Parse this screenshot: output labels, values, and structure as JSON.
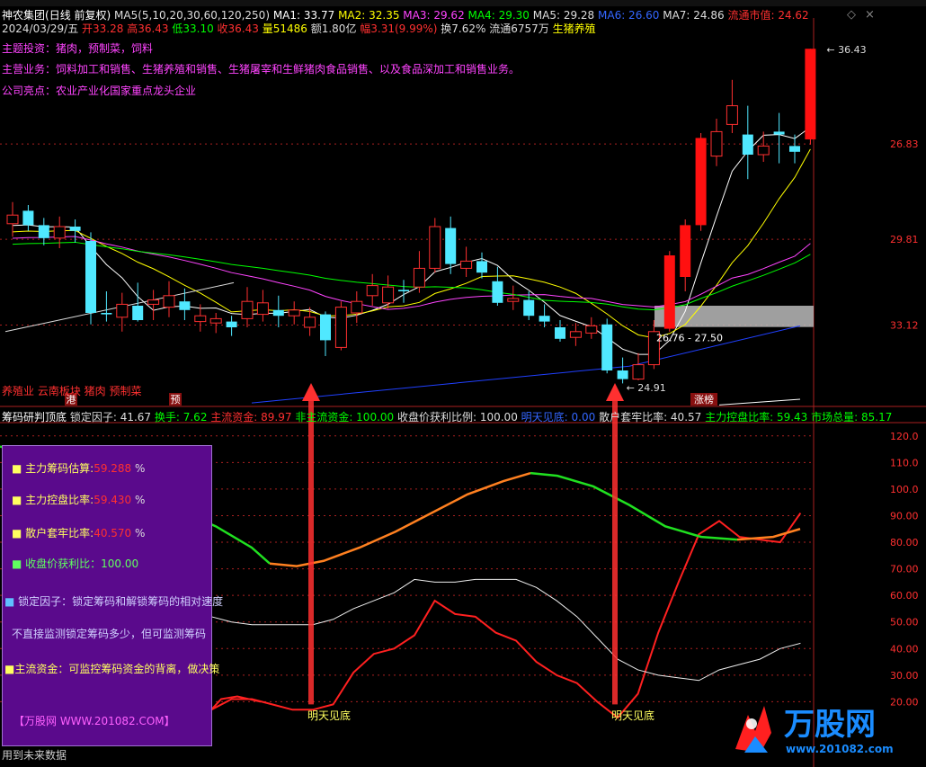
{
  "header": {
    "stock_name": "神农集团",
    "period_label": "(日线 前复权)",
    "ma": [
      {
        "label": "MA5(5,10,20,30,60,120,250)",
        "color": "#dddddd"
      },
      {
        "label": "MA1: 33.77",
        "color": "#ffffff"
      },
      {
        "label": "MA2: 32.35",
        "color": "#ffff00"
      },
      {
        "label": "MA3: 29.62",
        "color": "#ff44ff"
      },
      {
        "label": "MA4: 29.30",
        "color": "#00ff00"
      },
      {
        "label": "MA5: 29.28",
        "color": "#dddddd"
      },
      {
        "label": "MA6: 26.60",
        "color": "#3366ff"
      },
      {
        "label": "MA7: 24.86",
        "color": "#dddddd"
      },
      {
        "label": "流通市值: 24.62",
        "color": "#ff3030"
      }
    ],
    "quote": [
      {
        "label": "2024/03/29/五",
        "color": "#dddddd"
      },
      {
        "label": "开33.28",
        "color": "#ff3030"
      },
      {
        "label": "高36.43",
        "color": "#ff3030"
      },
      {
        "label": "低33.10",
        "color": "#00ff00"
      },
      {
        "label": "收36.43",
        "color": "#ff3030"
      },
      {
        "label": "量51486",
        "color": "#ffff00"
      },
      {
        "label": "额1.80亿",
        "color": "#dddddd"
      },
      {
        "label": "幅3.31(9.99%)",
        "color": "#ff3030"
      },
      {
        "label": "换7.62%",
        "color": "#dddddd"
      },
      {
        "label": "流通6757万",
        "color": "#dddddd"
      },
      {
        "label": "生猪养殖",
        "color": "#ffff00"
      }
    ],
    "info_lines": [
      "主题投资：猪肉，预制菜，饲料",
      "主营业务：饲料加工和销售、生猪养殖和销售、生猪屠宰和生鲜猪肉食品销售、以及食品深加工和销售业务。",
      "公司亮点：农业产业化国家重点龙头企业"
    ],
    "window_controls": [
      "◇",
      "×"
    ]
  },
  "price_panel": {
    "axis_labels": [
      "33.12",
      "29.81",
      "26.83"
    ],
    "high_label": "36.43",
    "low_label": "24.91",
    "zone_label": "26.76 - 27.50",
    "tags": [
      "养殖业 云南板块 猪肉 预制菜"
    ],
    "markers": [
      "港",
      "预",
      "涨榜"
    ]
  },
  "chart_data": [
    {
      "type": "candlestick",
      "title": "神农集团(日线 前复权)",
      "date_last": "2024/03/29",
      "y_ticks": [
        26.83,
        29.81,
        33.12
      ],
      "ylim": [
        24.0,
        37.5
      ],
      "candles": [
        [
          30.35,
          30.65,
          31.1,
          29.9
        ],
        [
          30.8,
          30.3,
          31.0,
          30.1
        ],
        [
          30.3,
          29.85,
          30.55,
          29.6
        ],
        [
          29.85,
          30.25,
          30.6,
          29.5
        ],
        [
          30.25,
          30.1,
          30.5,
          29.7
        ],
        [
          29.75,
          27.25,
          30.05,
          26.85
        ],
        [
          27.25,
          27.2,
          28.0,
          26.95
        ],
        [
          27.1,
          27.55,
          27.95,
          26.6
        ],
        [
          27.5,
          27.0,
          28.3,
          26.95
        ],
        [
          27.55,
          27.7,
          28.05,
          27.0
        ],
        [
          27.45,
          27.85,
          28.35,
          27.1
        ],
        [
          27.65,
          27.35,
          28.1,
          27.0
        ],
        [
          26.95,
          27.15,
          27.55,
          26.6
        ],
        [
          26.9,
          27.05,
          27.25,
          26.55
        ],
        [
          26.95,
          26.75,
          27.15,
          26.45
        ],
        [
          27.05,
          27.65,
          28.15,
          26.75
        ],
        [
          27.2,
          27.6,
          28.05,
          26.95
        ],
        [
          27.35,
          27.15,
          27.85,
          26.75
        ],
        [
          27.15,
          27.35,
          27.65,
          26.85
        ],
        [
          26.75,
          27.1,
          27.45,
          26.45
        ],
        [
          27.2,
          26.3,
          27.3,
          25.75
        ],
        [
          26.05,
          27.45,
          27.65,
          25.95
        ],
        [
          27.25,
          27.65,
          28.0,
          26.9
        ],
        [
          27.85,
          28.2,
          28.6,
          27.5
        ],
        [
          27.6,
          28.15,
          28.55,
          27.4
        ],
        [
          28.05,
          28.0,
          28.4,
          27.6
        ],
        [
          28.15,
          28.8,
          29.4,
          27.95
        ],
        [
          28.8,
          30.25,
          30.55,
          28.65
        ],
        [
          30.2,
          28.95,
          30.6,
          28.6
        ],
        [
          28.8,
          29.05,
          29.55,
          28.5
        ],
        [
          29.05,
          28.65,
          29.35,
          28.45
        ],
        [
          28.35,
          27.6,
          28.85,
          27.5
        ],
        [
          27.65,
          27.75,
          28.2,
          27.35
        ],
        [
          27.7,
          27.15,
          28.0,
          27.0
        ],
        [
          27.15,
          26.95,
          27.55,
          26.75
        ],
        [
          26.75,
          26.35,
          27.0,
          26.25
        ],
        [
          26.4,
          26.6,
          26.9,
          26.1
        ],
        [
          26.55,
          26.8,
          27.1,
          26.35
        ],
        [
          26.85,
          25.25,
          27.05,
          25.15
        ],
        [
          25.25,
          24.95,
          25.7,
          24.8
        ],
        [
          24.95,
          25.45,
          25.85,
          24.91
        ],
        [
          25.45,
          26.6,
          27.0,
          25.3
        ],
        [
          26.7,
          29.25,
          29.4,
          26.6
        ],
        [
          28.5,
          30.3,
          30.5,
          28.0
        ],
        [
          30.3,
          33.33,
          33.5,
          30.1
        ],
        [
          32.7,
          33.55,
          34.0,
          32.35
        ],
        [
          33.8,
          34.45,
          35.35,
          33.5
        ],
        [
          33.45,
          32.75,
          34.45,
          31.9
        ],
        [
          32.75,
          33.05,
          33.55,
          32.5
        ],
        [
          33.55,
          33.45,
          34.2,
          32.45
        ],
        [
          33.05,
          32.85,
          33.45,
          32.45
        ],
        [
          33.28,
          36.43,
          36.43,
          33.1
        ]
      ]
    },
    {
      "type": "line",
      "title": "筹码研判顶底",
      "ylim": [
        10,
        125
      ],
      "y_ticks": [
        20,
        30,
        40,
        50,
        60,
        70,
        80,
        90,
        100,
        110,
        120
      ],
      "series": [
        {
          "name": "锁定因子",
          "color": "#ff2020",
          "values": [
            [
              0,
              17
            ],
            [
              2,
              21
            ],
            [
              4,
              21
            ],
            [
              6,
              19
            ],
            [
              8,
              17
            ],
            [
              10,
              17
            ],
            [
              12,
              19
            ],
            [
              14,
              31
            ],
            [
              16,
              38
            ],
            [
              18,
              40
            ],
            [
              20,
              45
            ],
            [
              22,
              58
            ],
            [
              24,
              53
            ],
            [
              26,
              52
            ],
            [
              28,
              46
            ],
            [
              30,
              43
            ],
            [
              32,
              35
            ],
            [
              34,
              30
            ],
            [
              36,
              27
            ],
            [
              38,
              20
            ],
            [
              40,
              14
            ],
            [
              42,
              23
            ],
            [
              44,
              46
            ],
            [
              46,
              65
            ],
            [
              48,
              83
            ],
            [
              50,
              88
            ],
            [
              52,
              82
            ],
            [
              54,
              81
            ],
            [
              56,
              80
            ],
            [
              58,
              91
            ]
          ]
        },
        {
          "name": "收盘价获利比例",
          "color": "#eeeeee",
          "values": [
            [
              0,
              52
            ],
            [
              2,
              50
            ],
            [
              4,
              49
            ],
            [
              6,
              49
            ],
            [
              8,
              49
            ],
            [
              10,
              49
            ],
            [
              12,
              51
            ],
            [
              14,
              55
            ],
            [
              16,
              58
            ],
            [
              18,
              61
            ],
            [
              20,
              66
            ],
            [
              22,
              65
            ],
            [
              24,
              65
            ],
            [
              26,
              66
            ],
            [
              28,
              66
            ],
            [
              30,
              66
            ],
            [
              32,
              63
            ],
            [
              34,
              58
            ],
            [
              36,
              52
            ],
            [
              38,
              44
            ],
            [
              40,
              36
            ],
            [
              42,
              32
            ],
            [
              44,
              30
            ],
            [
              46,
              29
            ],
            [
              48,
              28
            ],
            [
              50,
              32
            ],
            [
              52,
              34
            ],
            [
              54,
              36
            ],
            [
              56,
              40
            ],
            [
              58,
              42
            ]
          ]
        }
      ],
      "marker_labels": [
        "明天见底",
        "明天见底"
      ]
    }
  ],
  "indicator_panel": {
    "title": "筹码研判顶底",
    "legend": [
      {
        "label": "锁定因子: 41.67",
        "color": "#dddddd"
      },
      {
        "label": "换手: 7.62",
        "color": "#00ff00"
      },
      {
        "label": "主流资金: 89.97",
        "color": "#ff3030"
      },
      {
        "label": "非主流资金: 100.00",
        "color": "#00ff00"
      },
      {
        "label": "收盘价获利比例: 100.00",
        "color": "#dddddd"
      },
      {
        "label": "明天见底: 0.00",
        "color": "#3366ff"
      },
      {
        "label": "散户套牢比率: 40.57",
        "color": "#dddddd"
      },
      {
        "label": "主力控盘比率: 59.43",
        "color": "#00ff00"
      },
      {
        "label": "市场总量: 85.17",
        "color": "#00ff00"
      }
    ],
    "axis_labels": [
      "120.0",
      "110.0",
      "100.0",
      "90.00",
      "80.00",
      "70.00",
      "60.00",
      "50.00",
      "40.00",
      "30.00",
      "20.00"
    ],
    "signal_label": "★明天见底"
  },
  "info_box": {
    "rows": [
      {
        "label": "主力筹码估算:",
        "value": "59.288",
        "unit": "%"
      },
      {
        "label": "主力控盘比率:",
        "value": "59.430",
        "unit": "%"
      },
      {
        "label": "散户套牢比率:",
        "value": "40.570",
        "unit": "%"
      }
    ],
    "profit_line": "收盘价获利比：100.00",
    "desc1": "锁定因子：锁定筹码和解锁筹码的相对速度",
    "desc2": "不直接监测锁定筹码多少，但可监测筹码",
    "desc3": "主流资金：可监控筹码资金的背离，做决策",
    "footer": "【万股网 WWW.201082.COM】"
  },
  "footer": {
    "text": "用到未来数据"
  },
  "watermark": {
    "brand": "万股网",
    "url": "www.201082.com"
  }
}
